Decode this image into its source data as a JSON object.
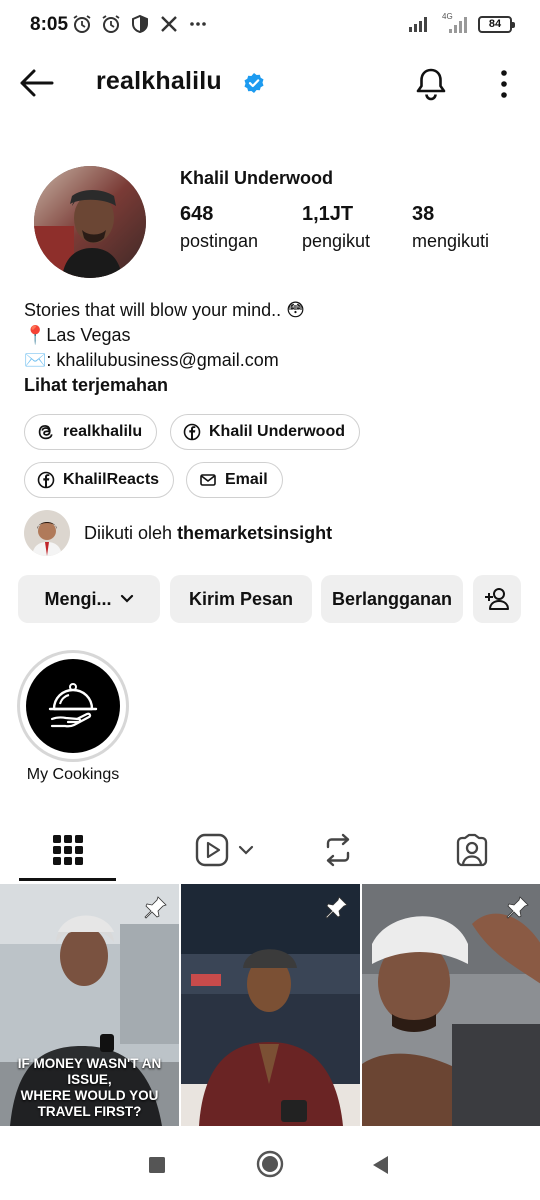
{
  "status_bar": {
    "time": "8:05",
    "network": "4G",
    "battery": "84"
  },
  "header": {
    "username": "realkhalilu",
    "verified": true
  },
  "profile": {
    "display_name": "Khalil Underwood",
    "stats": [
      {
        "value": "648",
        "label": "postingan"
      },
      {
        "value": "1,1JT",
        "label": "pengikut"
      },
      {
        "value": "38",
        "label": "mengikuti"
      }
    ],
    "bio": [
      "Stories that will blow your mind.. 😳",
      "📍Las Vegas",
      "✉️: khalilubusiness@gmail.com"
    ],
    "translate_label": "Lihat terjemahan"
  },
  "links": {
    "threads": "realkhalilu",
    "facebook": "Khalil Underwood",
    "facebook2": "KhalilReacts",
    "email": "Email"
  },
  "followed_by": {
    "prefix": "Diikuti oleh",
    "name": "themarketsinsight"
  },
  "actions": {
    "following": "Mengi...",
    "message": "Kirim Pesan",
    "subscribe": "Berlangganan"
  },
  "highlights": [
    {
      "label": "My Cookings"
    }
  ],
  "posts": [
    {
      "caption": "IF MONEY WASN'T AN ISSUE, WHERE WOULD YOU TRAVEL FIRST?",
      "pinned": true
    },
    {
      "caption": "",
      "pinned": true
    },
    {
      "caption": "",
      "pinned": true
    }
  ],
  "colors": {
    "verified": "#1d9bf0",
    "button_bg": "#efefef"
  }
}
